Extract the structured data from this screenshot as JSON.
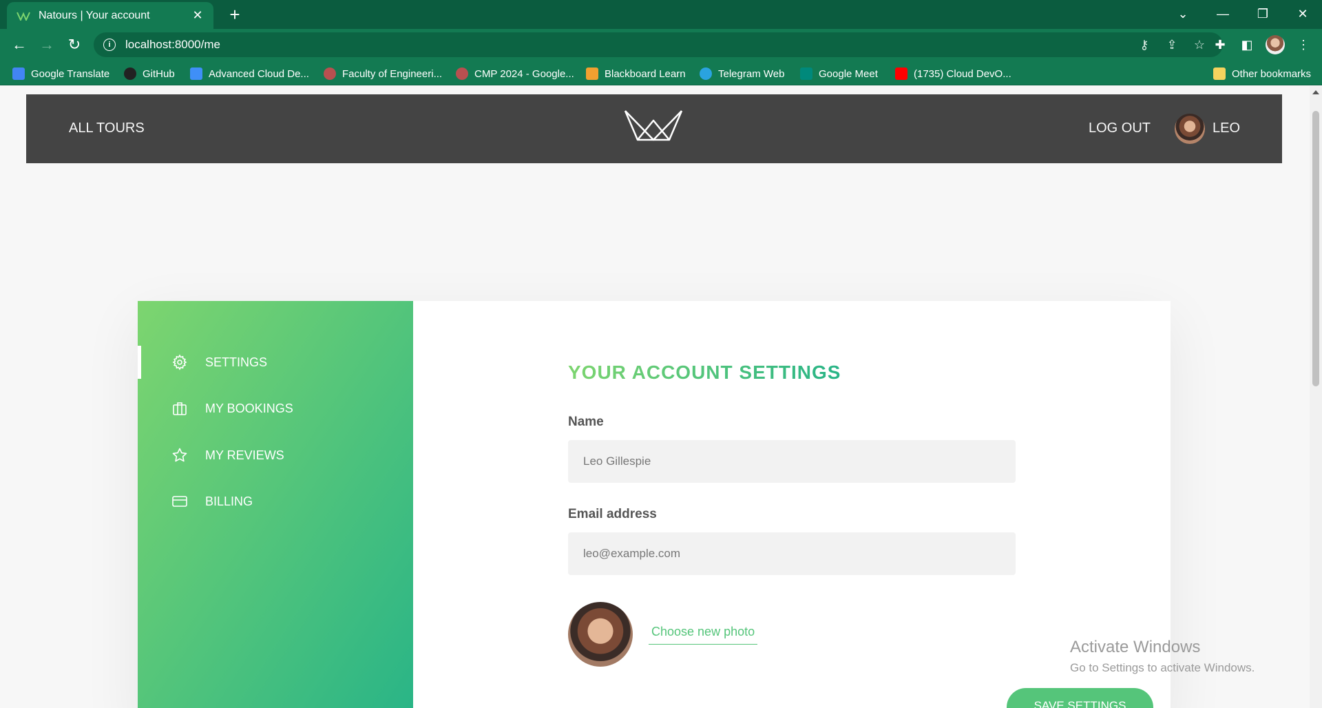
{
  "browser": {
    "tab_title": "Natours | Your account",
    "url": "localhost:8000/me",
    "bookmarks": [
      {
        "label": "Google Translate",
        "color": "#4285f4"
      },
      {
        "label": "GitHub",
        "color": "#222222"
      },
      {
        "label": "Advanced Cloud De...",
        "color": "#3f8ff7"
      },
      {
        "label": "Faculty of Engineeri...",
        "color": "#c04848"
      },
      {
        "label": "CMP 2024 - Google...",
        "color": "#c04848"
      },
      {
        "label": "Blackboard Learn",
        "color": "#f0a030"
      },
      {
        "label": "Telegram Web",
        "color": "#2aa3e0"
      },
      {
        "label": "Google Meet",
        "color": "#00897b"
      },
      {
        "label": "(1735) Cloud DevO...",
        "color": "#ff0000"
      }
    ],
    "other_bookmarks": "Other bookmarks"
  },
  "header": {
    "all_tours": "ALL TOURS",
    "log_out": "LOG OUT",
    "user_name": "LEO"
  },
  "sidebar": {
    "items": [
      {
        "label": "Settings",
        "icon": "settings-icon",
        "active": true
      },
      {
        "label": "My bookings",
        "icon": "briefcase-icon",
        "active": false
      },
      {
        "label": "My reviews",
        "icon": "star-icon",
        "active": false
      },
      {
        "label": "Billing",
        "icon": "credit-card-icon",
        "active": false
      }
    ]
  },
  "settings": {
    "heading": "Your account settings",
    "name_label": "Name",
    "name_value": "Leo Gillespie",
    "email_label": "Email address",
    "email_value": "leo@example.com",
    "choose_photo": "Choose new photo",
    "save_button": "Save settings"
  },
  "watermark": {
    "line1": "Activate Windows",
    "line2": "Go to Settings to activate Windows."
  },
  "colors": {
    "brand_green": "#55c57a",
    "gradient_light": "#7dd56f",
    "gradient_dark": "#28b487",
    "header_bg": "#444444",
    "chrome_bg": "#137a52"
  }
}
